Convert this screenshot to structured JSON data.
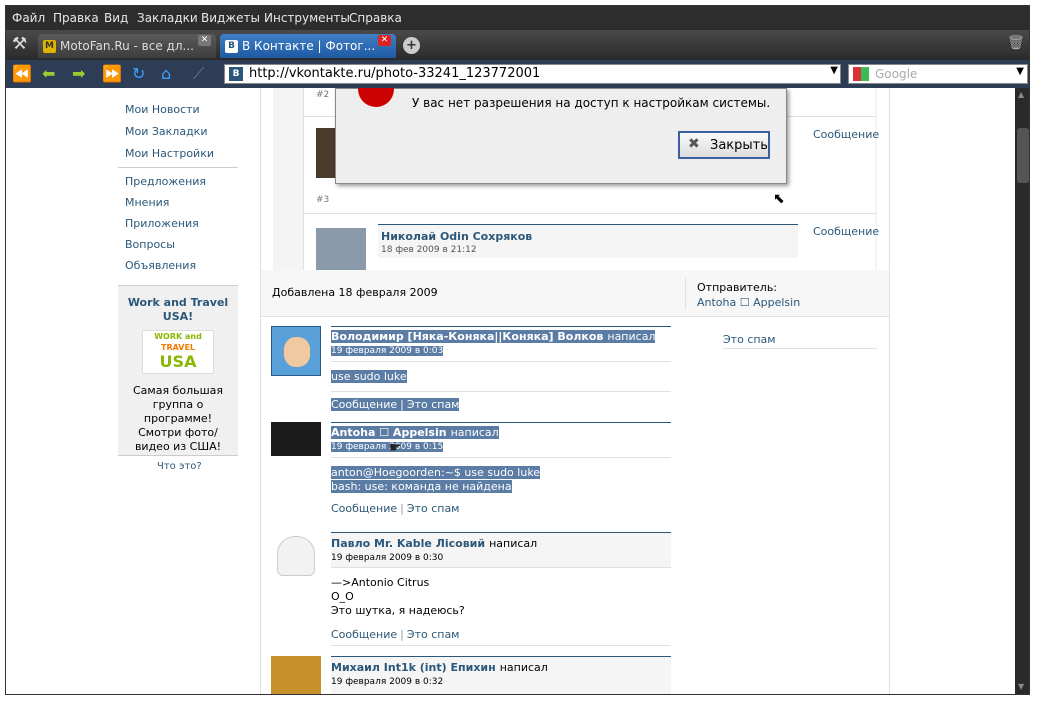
{
  "menu": [
    "Файл",
    "Правка",
    "Вид",
    "Закладки",
    "Виджеты",
    "Инструменты",
    "Справка"
  ],
  "tabs": [
    {
      "label": "MotoFan.Ru - все дл...",
      "icon": "M"
    },
    {
      "label": "В Контакте | Фотог...",
      "icon": "B"
    }
  ],
  "address": "http://vkontakte.ru/photo-33241_123772001",
  "search_placeholder": "Google",
  "sidebar": {
    "items": [
      "Мои Новости",
      "Мои Закладки",
      "Мои Настройки",
      "Предложения",
      "Мнения",
      "Приложения",
      "Вопросы",
      "Объявления"
    ],
    "ad_title": "Work and Travel USA!",
    "ad_logo_line1": "WORK and",
    "ad_logo_line2": "TRAVEL",
    "ad_logo_line3": "USA",
    "ad_text": "Самая большая группа о программе! Смотри фото/видео из США!",
    "what_is": "Что это?"
  },
  "dialog": {
    "message": "У вас нет разрешения на доступ к настройкам системы.",
    "close_label": "Закрыть"
  },
  "marks": [
    {
      "num": "#2"
    },
    {
      "num": "#3",
      "action": "Сообщение"
    },
    {
      "name": "Николай Odin Сохряков",
      "date": "18 фев 2009 в 21:12",
      "action": "Сообщение"
    }
  ],
  "photo_info": {
    "added": "Добавлена 18 февраля 2009",
    "sender_label": "Отправитель:",
    "sender": "Antoha ☐ Appelsin",
    "spam": "Это спам"
  },
  "comments": [
    {
      "name": "Володимир [Няка-Коняка||Коняка] Волков",
      "wrote": "написал",
      "date": "19 февраля 2009 в 0:03",
      "text": [
        "use sudo luke"
      ],
      "msg": "Сообщение",
      "sep": "|",
      "spam": "Это спам"
    },
    {
      "name": "Antoha ☐ Appelsin",
      "wrote": "написал",
      "date": "19 февраля 2009 в 0:15",
      "text": [
        "anton@Hoegoorden:~$ use sudo luke",
        "bash: use: команда не найдена"
      ],
      "msg": "Сообщение",
      "sep": "|",
      "spam": "Это спам"
    },
    {
      "name": "Павло Mr. Kable Лісовий",
      "wrote": "написал",
      "date": "19 февраля 2009 в 0:30",
      "text": [
        "—>Antonio Citrus",
        "O_O",
        "Это шутка, я надеюсь?"
      ],
      "msg": "Сообщение",
      "sep": "|",
      "spam": "Это спам"
    },
    {
      "name": "Михаил Int1k (int) Епихин",
      "wrote": "написал",
      "date": "19 февраля 2009 в 0:32"
    }
  ]
}
